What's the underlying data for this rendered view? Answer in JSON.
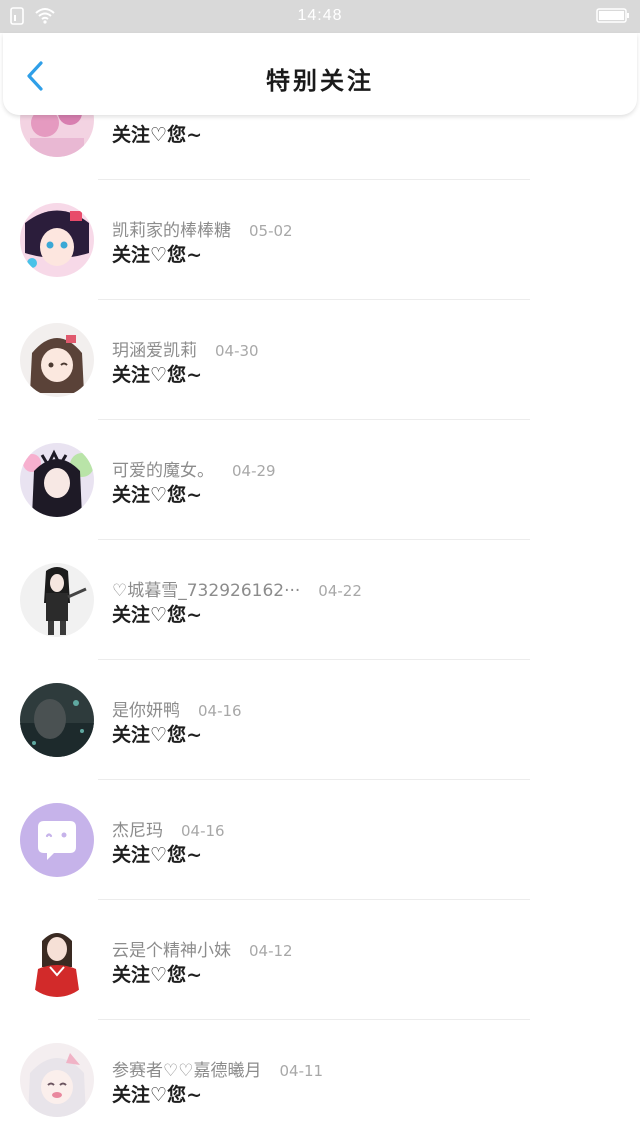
{
  "status": {
    "time": "14:48"
  },
  "header": {
    "title": "特别关注"
  },
  "rows": [
    {
      "name": "",
      "date": "",
      "message_a": "关注",
      "heart": "♡",
      "message_b": "您~"
    },
    {
      "name": "凯莉家的棒棒糖",
      "date": "05-02",
      "message_a": "关注",
      "heart": "♡",
      "message_b": "您~"
    },
    {
      "name": "玥涵爱凯莉",
      "date": "04-30",
      "message_a": "关注",
      "heart": "♡",
      "message_b": "您~"
    },
    {
      "name": "可爱的魔女。",
      "date": "04-29",
      "message_a": "关注",
      "heart": "♡",
      "message_b": "您~"
    },
    {
      "name": "♡城暮雪_732926162···",
      "date": "04-22",
      "message_a": "关注",
      "heart": "♡",
      "message_b": "您~"
    },
    {
      "name": "是你妍鸭",
      "date": "04-16",
      "message_a": "关注",
      "heart": "♡",
      "message_b": "您~"
    },
    {
      "name": "杰尼玛",
      "date": "04-16",
      "message_a": "关注",
      "heart": "♡",
      "message_b": "您~"
    },
    {
      "name": "云是个精神小妹",
      "date": "04-12",
      "message_a": "关注",
      "heart": "♡",
      "message_b": "您~"
    },
    {
      "name": "参赛者♡♡嘉德曦月",
      "date": "04-11",
      "message_a": "关注",
      "heart": "♡",
      "message_b": "您~"
    }
  ],
  "colors": {
    "back_arrow": "#2f9fe8",
    "status_bar": "#d9d9d9",
    "avatar_placeholder": "#c6b3ea"
  }
}
